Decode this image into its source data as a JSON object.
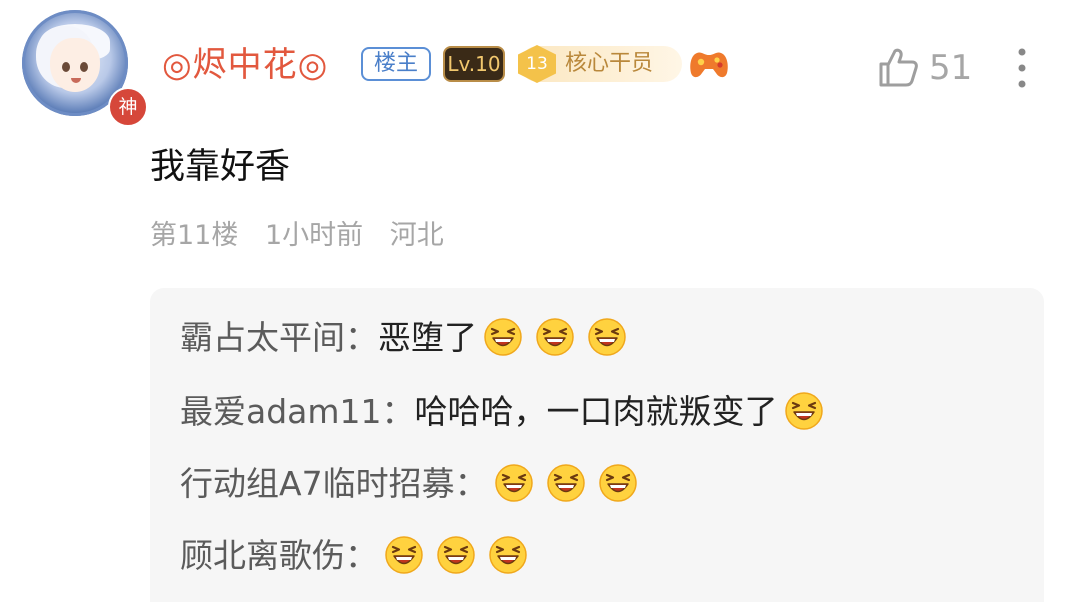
{
  "user": {
    "name": "◎烬中花◎",
    "avatar_badge": "神",
    "op_tag": "楼主",
    "level": "Lv.10",
    "rank_number": "13",
    "rank_title": "核心干员"
  },
  "actions": {
    "like_count": "51"
  },
  "post": {
    "text": "我靠好香",
    "floor": "第11楼",
    "time": "1小时前",
    "location": "河北"
  },
  "replies": [
    {
      "author": "霸占太平间",
      "sep": "：",
      "text": "恶堕了",
      "emoji_count": 3
    },
    {
      "author": "最爱adam11",
      "sep": "：",
      "text": "哈哈哈，一口肉就叛变了",
      "emoji_count": 1
    },
    {
      "author": "行动组A7临时招募",
      "sep": "：",
      "text": "",
      "emoji_count": 3
    },
    {
      "author": "顾北离歌伤",
      "sep": "：",
      "text": "",
      "emoji_count": 3
    }
  ],
  "icons": {
    "like": "thumbs-up-icon",
    "more": "more-vertical-icon",
    "emoji": "laughing-emoji-icon",
    "gamepad": "gamepad-icon"
  },
  "colors": {
    "username": "#e2583e",
    "op_tag": "#4a7fc9",
    "rank": "#b9883b",
    "meta": "#a6a6a6",
    "reply_bg": "#f6f6f6"
  }
}
